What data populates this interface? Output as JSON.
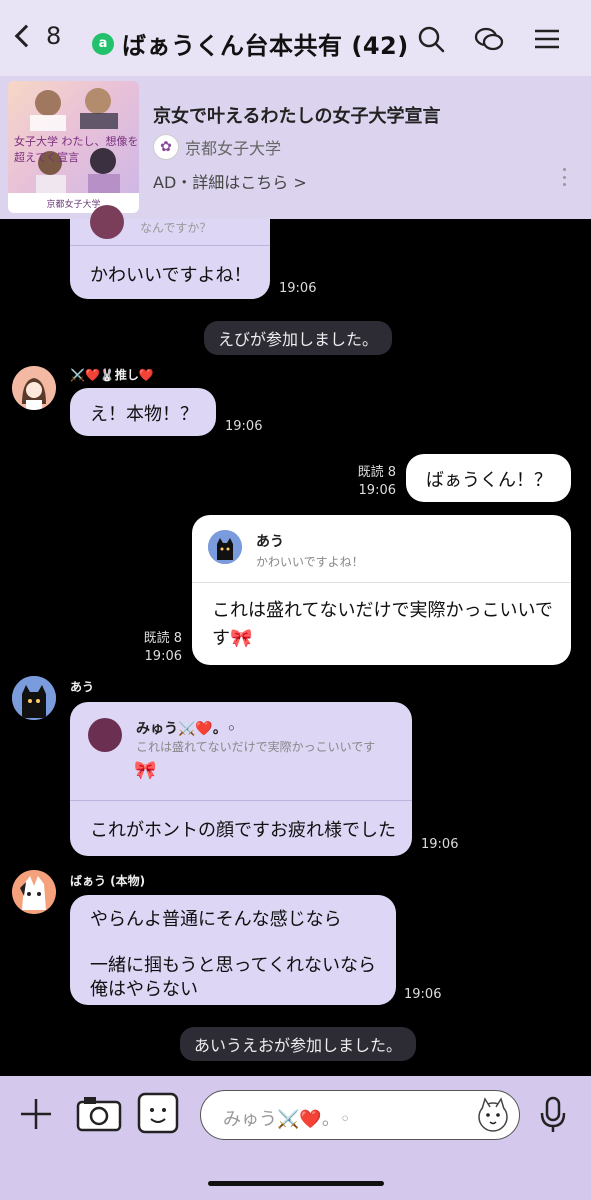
{
  "header": {
    "back_count": "8",
    "badge": "a",
    "title": "ばぁうくん台本共有 (42)"
  },
  "ad": {
    "title": "京女で叶えるわたしの女子大学宣言",
    "sponsor": "京都女子大学",
    "meta": "AD・詳細はこちら >",
    "image_caption": "京都女子大学",
    "image_text": "女子大学 わたし、想像を超えてく宣言"
  },
  "messages": [
    {
      "quote_top": "なんですか？",
      "text": "かわいいですよね！",
      "time": "19:06"
    },
    {
      "system": "えびが参加しました。"
    },
    {
      "sender": "⚔️❤️🐰推し❤️",
      "text": "え！本物！？",
      "time": "19:06"
    },
    {
      "read": "既読 8",
      "time": "19:06",
      "text": "ばぁうくん！？"
    },
    {
      "read": "既読 8",
      "time": "19:06",
      "quote_name": "あう",
      "quote_text": "かわいいですよね！",
      "text": "これは盛れてないだけで実際かっこいいです🎀"
    },
    {
      "sender": "あう",
      "quote_name": "みゅう⚔️❤️。◦",
      "quote_text": "これは盛れてないだけで実際かっこいいです",
      "text": "これがホントの顔ですお疲れ様でした",
      "time": "19:06"
    },
    {
      "sender": "ばぁう (本物)",
      "line1": "やらんよ普通にそんな感じなら",
      "line2": "一緒に掴もうと思ってくれないなら",
      "line3": "俺はやらない",
      "time": "19:06"
    },
    {
      "system": "あいうえおが参加しました。"
    }
  ],
  "input": {
    "placeholder": "みゅう⚔️❤️。◦"
  },
  "colors": {
    "header_bg": "#e9e4f5",
    "bubble_purple": "#ddd6f5",
    "bottom_bar": "#d4c8ec",
    "badge_green": "#22c16b"
  }
}
